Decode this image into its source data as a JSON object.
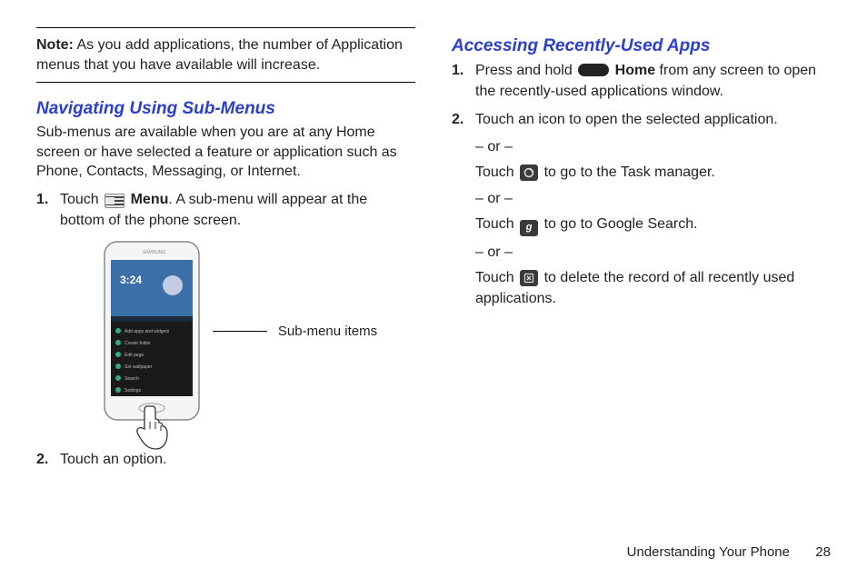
{
  "left": {
    "note_label": "Note:",
    "note_text": "As you add applications, the number of Application menus that you have available will increase.",
    "section1_head": "Navigating Using Sub-Menus",
    "section1_body": "Sub-menus are available when you are at any Home screen or have selected a feature or application such as Phone, Contacts, Messaging, or Internet.",
    "step1_num": "1.",
    "step1_a": "Touch ",
    "step1_menu": "Menu",
    "step1_b": ". A sub-menu will appear at the bottom of the phone screen.",
    "callout": "Sub-menu items",
    "step2_num": "2.",
    "step2": "Touch an option."
  },
  "right": {
    "section2_head": "Accessing Recently-Used Apps",
    "r1_num": "1.",
    "r1_a": "Press and hold ",
    "r1_home": "Home",
    "r1_b": " from any screen to open the recently-used applications window.",
    "r2_num": "2.",
    "r2": "Touch an icon to open the selected application.",
    "or": "– or –",
    "r3_a": "Touch ",
    "r3_b": " to go to the Task manager.",
    "r4_a": "Touch ",
    "r4_b": " to go to Google Search.",
    "r5_a": "Touch ",
    "r5_b": " to delete the record of all recently used applications."
  },
  "footer": {
    "chapter": "Understanding Your Phone",
    "page": "28"
  },
  "icons": {
    "google_g": "g"
  }
}
